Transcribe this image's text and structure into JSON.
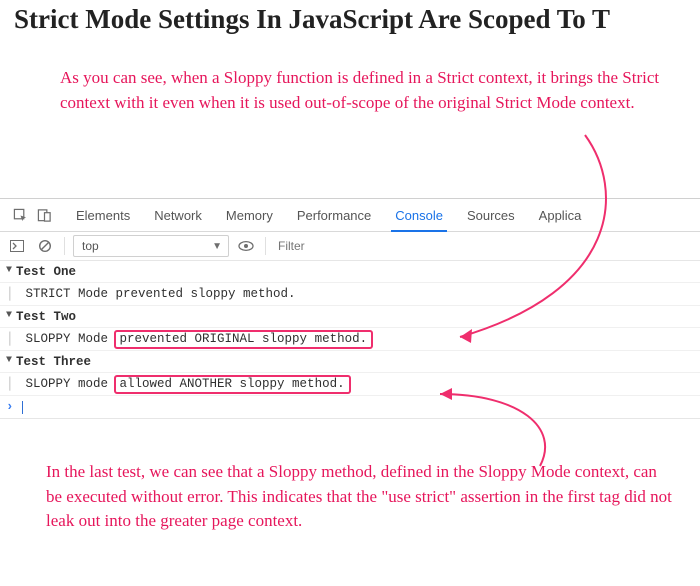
{
  "header": {
    "title": "Strict Mode Settings In JavaScript Are Scoped To T"
  },
  "annotations": {
    "top": "As you can see, when a Sloppy function is defined in a Strict context, it brings the Strict context with it even when it is used out-of-scope of the original Strict Mode context.",
    "bottom": "In the last test, we can see that a Sloppy method, defined in the Sloppy Mode context, can be executed without error. This indicates that the \"use strict\" assertion in the first tag did not leak out into the greater page context."
  },
  "devtools": {
    "tabs": {
      "elements": "Elements",
      "network": "Network",
      "memory": "Memory",
      "performance": "Performance",
      "console": "Console",
      "sources": "Sources",
      "application": "Applica"
    },
    "toolbar": {
      "context": "top",
      "filter_placeholder": "Filter"
    },
    "console": {
      "groups": [
        {
          "label": "Test One",
          "message_prefix": "STRICT Mode prevented sloppy method.",
          "message_highlight": ""
        },
        {
          "label": "Test Two",
          "message_prefix": "SLOPPY Mode ",
          "message_highlight": "prevented ORIGINAL sloppy method."
        },
        {
          "label": "Test Three",
          "message_prefix": "SLOPPY mode ",
          "message_highlight": "allowed ANOTHER sloppy method."
        }
      ]
    }
  }
}
